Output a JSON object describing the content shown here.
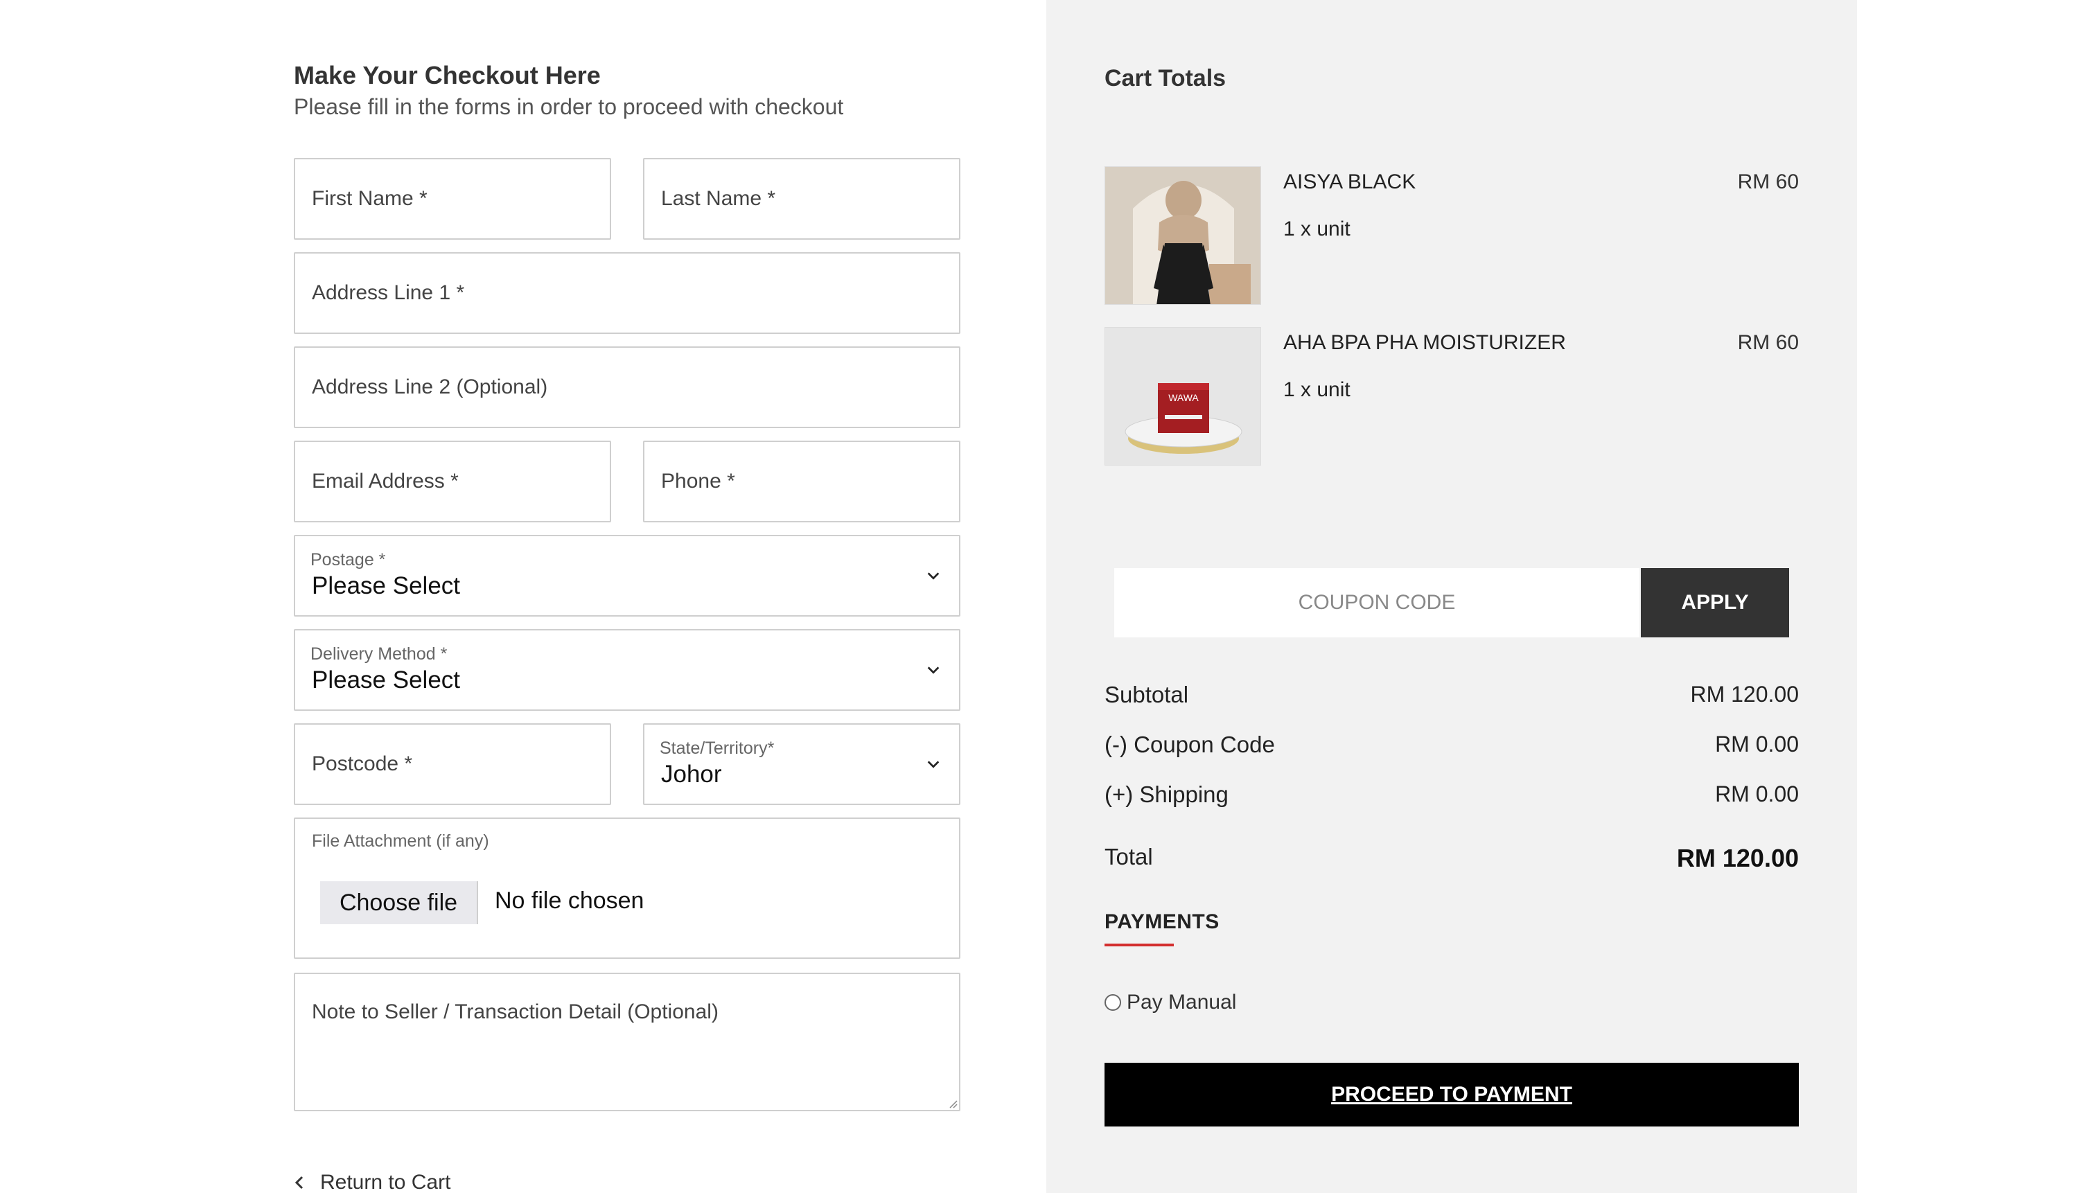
{
  "checkout": {
    "title": "Make Your Checkout Here",
    "subtitle": "Please fill in the forms in order to proceed with checkout"
  },
  "form": {
    "first_name_placeholder": "First Name *",
    "last_name_placeholder": "Last Name *",
    "address1_placeholder": "Address Line 1 *",
    "address2_placeholder": "Address Line 2 (Optional)",
    "email_placeholder": "Email Address *",
    "phone_placeholder": "Phone *",
    "postage": {
      "label": "Postage *",
      "value": "Please Select"
    },
    "delivery": {
      "label": "Delivery Method *",
      "value": "Please Select"
    },
    "postcode_placeholder": "Postcode *",
    "state": {
      "label": "State/Territory*",
      "value": "Johor"
    },
    "file": {
      "label": "File Attachment (if any)",
      "button": "Choose file",
      "status": "No file chosen"
    },
    "note_placeholder": "Note to Seller / Transaction Detail (Optional)",
    "return_link": "Return to Cart"
  },
  "cart": {
    "title": "Cart Totals",
    "items": [
      {
        "name": "AISYA BLACK",
        "qty": "1 x unit",
        "price": "RM 60"
      },
      {
        "name": "AHA BPA PHA MOISTURIZER",
        "qty": "1 x unit",
        "price": "RM 60"
      }
    ],
    "product_badge_text": "WAWA",
    "coupon_placeholder": "COUPON CODE",
    "apply_label": "APPLY",
    "summary": {
      "subtotal_label": "Subtotal",
      "subtotal_value": "RM 120.00",
      "coupon_label": "(-) Coupon Code",
      "coupon_value": "RM 0.00",
      "shipping_label": "(+) Shipping",
      "shipping_value": "RM 0.00",
      "total_label": "Total",
      "total_value": "RM 120.00"
    },
    "payments_heading": "PAYMENTS",
    "payment_option": "Pay Manual",
    "proceed_label": "PROCEED TO PAYMENT"
  },
  "colors": {
    "accent_red": "#d32f2f",
    "panel_bg": "#f2f2f2",
    "button_dark": "#333333",
    "proceed_bg": "#000000"
  },
  "icons": {
    "select_arrow": "chevron-down-icon",
    "back_arrow": "chevron-left-icon"
  }
}
